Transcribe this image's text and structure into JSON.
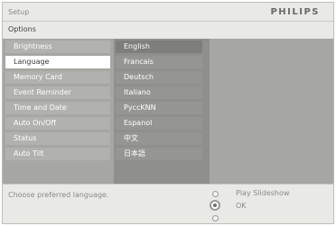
{
  "header": {
    "section": "Setup",
    "brand": "PHILIPS"
  },
  "options_label": "Options",
  "menu": {
    "items": [
      {
        "label": "Brightness",
        "selected": false
      },
      {
        "label": "Language",
        "selected": true
      },
      {
        "label": "Memory Card",
        "selected": false
      },
      {
        "label": "Event Reminder",
        "selected": false
      },
      {
        "label": "Time and Date",
        "selected": false
      },
      {
        "label": "Auto On/Off",
        "selected": false
      },
      {
        "label": "Status",
        "selected": false
      },
      {
        "label": "Auto Tilt",
        "selected": false
      }
    ]
  },
  "submenu": {
    "items": [
      {
        "label": "English",
        "highlight": true
      },
      {
        "label": "Francais",
        "highlight": false
      },
      {
        "label": "Deutsch",
        "highlight": false
      },
      {
        "label": "Italiano",
        "highlight": false
      },
      {
        "label": "PyccKNN",
        "highlight": false
      },
      {
        "label": "Espanol",
        "highlight": false
      },
      {
        "label": "中文",
        "highlight": false
      },
      {
        "label": "日本語",
        "highlight": false
      }
    ]
  },
  "footer": {
    "hint": "Choose preferred language.",
    "play_slideshow": "Play Slideshow",
    "ok": "OK"
  }
}
